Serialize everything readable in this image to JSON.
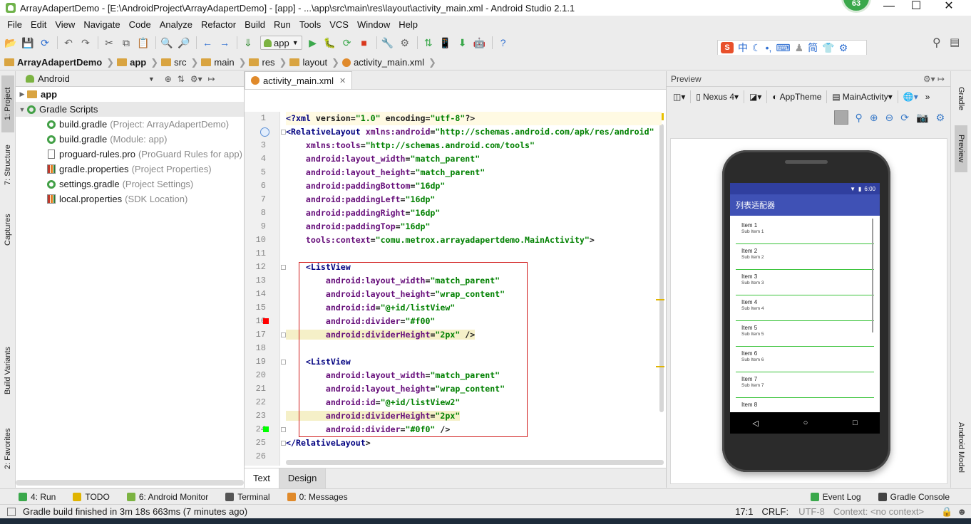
{
  "window": {
    "title": "ArrayAdapertDemo - [E:\\AndroidProject\\ArrayAdapertDemo] - [app] - ...\\app\\src\\main\\res\\layout\\activity_main.xml - Android Studio 2.1.1",
    "badge": "63"
  },
  "menu": [
    "File",
    "Edit",
    "View",
    "Navigate",
    "Code",
    "Analyze",
    "Refactor",
    "Build",
    "Run",
    "Tools",
    "VCS",
    "Window",
    "Help"
  ],
  "toolbar": {
    "run_config": "app"
  },
  "ime": {
    "lang": "中",
    "simplified": "简"
  },
  "breadcrumb": [
    "ArrayAdapertDemo",
    "app",
    "src",
    "main",
    "res",
    "layout",
    "activity_main.xml"
  ],
  "left_tabs": {
    "project": "1: Project",
    "structure": "7: Structure",
    "captures": "Captures",
    "build_variants": "Build Variants",
    "favorites": "2: Favorites"
  },
  "right_tabs": {
    "gradle": "Gradle",
    "preview": "Preview",
    "android_model": "Android Model"
  },
  "project": {
    "view_mode": "Android",
    "tree": [
      {
        "label": "app",
        "hint": "",
        "type": "folder",
        "level": 0
      },
      {
        "label": "Gradle Scripts",
        "hint": "",
        "type": "gradle",
        "level": 0
      },
      {
        "label": "build.gradle",
        "hint": "(Project: ArrayAdapertDemo)",
        "type": "gradle",
        "level": 1
      },
      {
        "label": "build.gradle",
        "hint": "(Module: app)",
        "type": "gradle",
        "level": 1
      },
      {
        "label": "proguard-rules.pro",
        "hint": "(ProGuard Rules for app)",
        "type": "file",
        "level": 1
      },
      {
        "label": "gradle.properties",
        "hint": "(Project Properties)",
        "type": "props",
        "level": 1
      },
      {
        "label": "settings.gradle",
        "hint": "(Project Settings)",
        "type": "gradle",
        "level": 1
      },
      {
        "label": "local.properties",
        "hint": "(SDK Location)",
        "type": "props",
        "level": 1
      }
    ]
  },
  "editor": {
    "tab": "activity_main.xml",
    "bottom_tabs": [
      "Text",
      "Design"
    ],
    "line_numbers": [
      "1",
      "2",
      "3",
      "4",
      "5",
      "6",
      "7",
      "8",
      "9",
      "10",
      "11",
      "12",
      "13",
      "14",
      "15",
      "16",
      "17",
      "18",
      "19",
      "20",
      "21",
      "22",
      "23",
      "24",
      "25",
      "26"
    ],
    "lines": [
      "<?xml version=\"1.0\" encoding=\"utf-8\"?>",
      "<RelativeLayout xmlns:android=\"http://schemas.android.com/apk/res/android\"",
      "    xmlns:tools=\"http://schemas.android.com/tools\"",
      "    android:layout_width=\"match_parent\"",
      "    android:layout_height=\"match_parent\"",
      "    android:paddingBottom=\"16dp\"",
      "    android:paddingLeft=\"16dp\"",
      "    android:paddingRight=\"16dp\"",
      "    android:paddingTop=\"16dp\"",
      "    tools:context=\"comu.metrox.arrayadapertdemo.MainActivity\">",
      "",
      "    <ListView",
      "        android:layout_width=\"match_parent\"",
      "        android:layout_height=\"wrap_content\"",
      "        android:id=\"@+id/listView\"",
      "        android:divider=\"#f00\"",
      "        android:dividerHeight=\"2px\" />",
      "",
      "    <ListView",
      "        android:layout_width=\"match_parent\"",
      "        android:layout_height=\"wrap_content\"",
      "        android:id=\"@+id/listView2\"",
      "        android:dividerHeight=\"2px\"",
      "        android:divider=\"#0f0\" />",
      "</RelativeLayout>",
      ""
    ]
  },
  "preview": {
    "label": "Preview",
    "device": "Nexus 4",
    "theme": "AppTheme",
    "activity": "MainActivity",
    "phone": {
      "time": "6:00",
      "app_title": "列表适配器",
      "items": [
        {
          "title": "Item 1",
          "sub": "Sub Item 1"
        },
        {
          "title": "Item 2",
          "sub": "Sub Item 2"
        },
        {
          "title": "Item 3",
          "sub": "Sub Item 3"
        },
        {
          "title": "Item 4",
          "sub": "Sub Item 4"
        },
        {
          "title": "Item 5",
          "sub": "Sub Item 5"
        },
        {
          "title": "Item 6",
          "sub": "Sub Item 6"
        },
        {
          "title": "Item 7",
          "sub": "Sub Item 7"
        },
        {
          "title": "Item 8",
          "sub": ""
        }
      ]
    }
  },
  "bottom_tools": [
    "4: Run",
    "TODO",
    "6: Android Monitor",
    "Terminal",
    "0: Messages",
    "Event Log",
    "Gradle Console"
  ],
  "status": {
    "message": "Gradle build finished in 3m 18s 663ms (7 minutes ago)",
    "position": "17:1",
    "line_sep": "CRLF:",
    "encoding": "UTF-8",
    "context": "Context: <no context>"
  },
  "colors": {
    "accent": "#3f51b5",
    "status_bar": "#303f9f",
    "divider_green": "#39c339",
    "highlight_box": "#d01a1a"
  }
}
